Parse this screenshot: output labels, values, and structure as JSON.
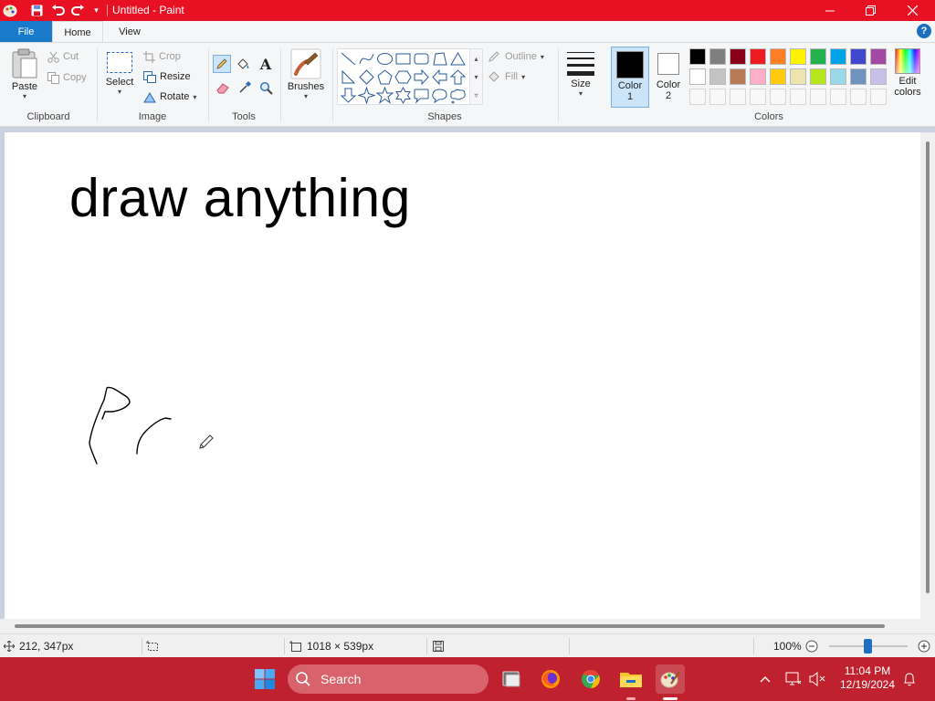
{
  "window": {
    "title": "Untitled - Paint",
    "controls": [
      "minimize",
      "maximize",
      "close"
    ]
  },
  "quick_access": [
    "paint-app-icon",
    "save-icon",
    "undo-icon",
    "redo-icon",
    "customize-dropdown-icon"
  ],
  "tabs": {
    "file": "File",
    "home": "Home",
    "view": "View"
  },
  "ribbon": {
    "clipboard": {
      "group_label": "Clipboard",
      "paste": "Paste",
      "cut": "Cut",
      "copy": "Copy"
    },
    "image": {
      "group_label": "Image",
      "select": "Select",
      "crop": "Crop",
      "resize": "Resize",
      "rotate": "Rotate"
    },
    "tools": {
      "group_label": "Tools",
      "items": [
        "pencil-icon",
        "fill-bucket-icon",
        "text-icon",
        "eraser-icon",
        "color-picker-icon",
        "magnifier-icon"
      ],
      "text_glyph": "A"
    },
    "brushes": {
      "label": "Brushes"
    },
    "shapes": {
      "group_label": "Shapes",
      "items": [
        "line-shape-icon",
        "curve-shape-icon",
        "oval-shape-icon",
        "rectangle-shape-icon",
        "rounded-rectangle-shape-icon",
        "polygon-shape-icon",
        "triangle-shape-icon",
        "right-triangle-shape-icon",
        "diamond-shape-icon",
        "pentagon-shape-icon",
        "hexagon-shape-icon",
        "right-arrow-shape-icon",
        "left-arrow-shape-icon",
        "up-arrow-shape-icon",
        "down-arrow-shape-icon",
        "four-point-star-shape-icon",
        "five-point-star-shape-icon",
        "six-point-star-shape-icon",
        "rounded-callout-shape-icon",
        "oval-callout-shape-icon",
        "cloud-callout-shape-icon"
      ],
      "outline": "Outline",
      "fill": "Fill"
    },
    "size": {
      "label": "Size"
    },
    "color1": {
      "label_top": "Color",
      "label_bottom": "1",
      "value": "#000000"
    },
    "color2": {
      "label_top": "Color",
      "label_bottom": "2",
      "value": "#ffffff"
    },
    "colors": {
      "group_label": "Colors",
      "row1": [
        "#000000",
        "#7f7f7f",
        "#880015",
        "#ed1c24",
        "#ff7f27",
        "#fff200",
        "#22b14c",
        "#00a2e8",
        "#3f48cc",
        "#a349a4"
      ],
      "row2": [
        "#ffffff",
        "#c3c3c3",
        "#b97a57",
        "#ffaec9",
        "#ffc90e",
        "#efe4b0",
        "#b5e61d",
        "#99d9ea",
        "#7092be",
        "#c8bfe7"
      ],
      "row3_empty_count": 10,
      "edit_top": "Edit",
      "edit_bottom": "colors"
    }
  },
  "canvas": {
    "text": "draw anything",
    "background": "#ffffff"
  },
  "status": {
    "cursor_position": "212, 347px",
    "selection_size": "",
    "canvas_size": "1018 × 539px",
    "zoom": "100%",
    "zoom_fraction": 0.5
  },
  "taskbar": {
    "search_label": "Search",
    "apps": [
      "windows-start-icon",
      "search-icon",
      "task-view-icon",
      "firefox-icon",
      "chrome-icon",
      "file-explorer-icon",
      "paint-taskbar-icon"
    ],
    "time": "11:04 PM",
    "date": "12/19/2024"
  },
  "colors_theme": {
    "title_bar": "#e81123",
    "file_tab": "#1979ca",
    "taskbar": "#c0212e",
    "accent": "#1e6fc4"
  }
}
